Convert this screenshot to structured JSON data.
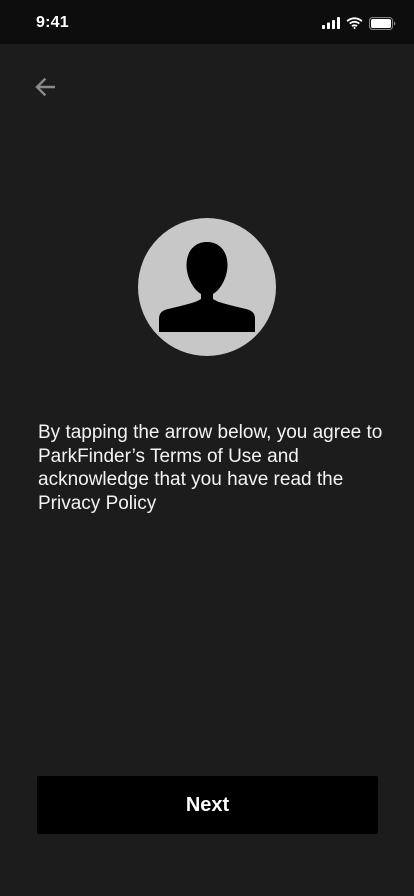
{
  "status_bar": {
    "time": "9:41",
    "icons": [
      "cellular-signal-icon",
      "wifi-icon",
      "battery-icon"
    ]
  },
  "nav": {
    "back_icon": "arrow-left-icon"
  },
  "avatar": {
    "icon": "user-silhouette-icon"
  },
  "consent": {
    "text": "By tapping the arrow below, you agree to ParkFinder’s Terms of Use and acknowledge that you have read the Privacy Policy"
  },
  "actions": {
    "next_label": "Next"
  },
  "colors": {
    "background": "#1c1c1c",
    "status_bar_background": "#0d0d0d",
    "avatar_background": "#c7c7c7",
    "avatar_silhouette": "#000000",
    "button_background": "#000000",
    "text": "#ffffff",
    "back_icon": "#8a8a8a"
  }
}
